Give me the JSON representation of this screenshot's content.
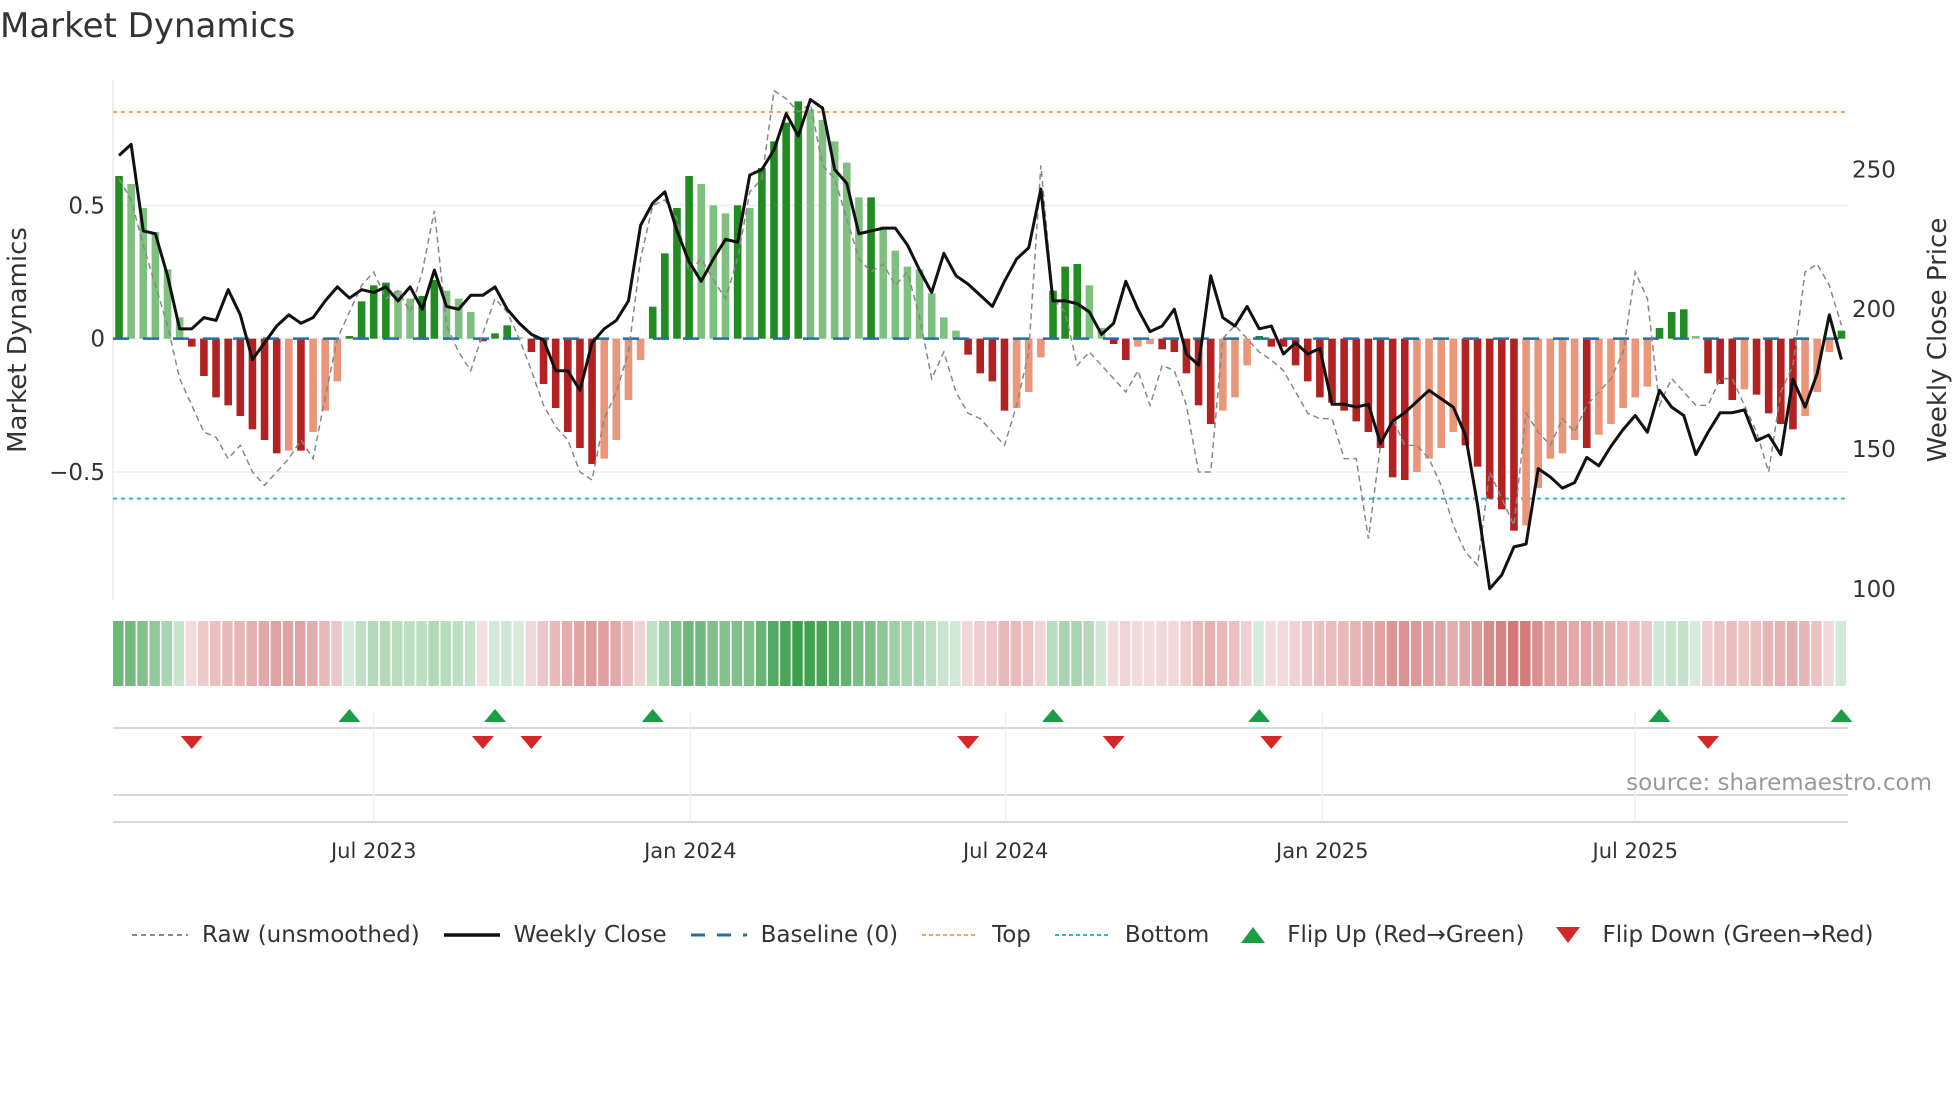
{
  "title": "Market Dynamics",
  "source": "source: sharemaestro.com",
  "colors": {
    "up_strong": "#228b22",
    "up_weak": "#7fbf7f",
    "down_strong": "#b22222",
    "down_weak": "#e9967a",
    "top": "#f4a460",
    "bottom": "#22bcd4",
    "baseline": "#1f6fa8",
    "price": "#111111",
    "raw": "#888888",
    "flip_up": "#1a9e45",
    "flip_down": "#d62728"
  },
  "legend": [
    {
      "key": "raw",
      "label": "Raw (unsmoothed)"
    },
    {
      "key": "price",
      "label": "Weekly Close"
    },
    {
      "key": "baseline",
      "label": "Baseline (0)"
    },
    {
      "key": "top",
      "label": "Top"
    },
    {
      "key": "bottom",
      "label": "Bottom"
    },
    {
      "key": "flip_up",
      "label": "Flip Up (Red→Green)"
    },
    {
      "key": "flip_down",
      "label": "Flip Down (Green→Red)"
    }
  ],
  "chart_data": {
    "type": "bar",
    "ylabel": "Market Dynamics",
    "y2label": "Weekly Close Price",
    "ylim": [
      -0.98,
      0.97
    ],
    "y2lim": [
      96,
      282
    ],
    "yticks": [
      {
        "v": 0.5,
        "label": "0.5"
      },
      {
        "v": 0,
        "label": "0"
      },
      {
        "v": -0.5,
        "label": "−0.5"
      }
    ],
    "y2ticks": [
      {
        "v": 250,
        "label": "250"
      },
      {
        "v": 200,
        "label": "200"
      },
      {
        "v": 150,
        "label": "150"
      },
      {
        "v": 100,
        "label": "100"
      }
    ],
    "xticks": [
      {
        "week": 21,
        "label": "Jul 2023"
      },
      {
        "week": 47.1,
        "label": "Jan 2024"
      },
      {
        "week": 73.1,
        "label": "Jul 2024"
      },
      {
        "week": 99.2,
        "label": "Jan 2025"
      },
      {
        "week": 125,
        "label": "Jul 2025"
      }
    ],
    "top": 0.85,
    "bottom": -0.6,
    "baseline": 0,
    "smoothed": [
      0.61,
      0.58,
      0.49,
      0.4,
      0.26,
      0.08,
      -0.03,
      -0.14,
      -0.22,
      -0.25,
      -0.29,
      -0.34,
      -0.38,
      -0.43,
      -0.42,
      -0.42,
      -0.35,
      -0.27,
      -0.16,
      0.01,
      0.14,
      0.2,
      0.21,
      0.18,
      0.15,
      0.16,
      0.22,
      0.18,
      0.15,
      0.1,
      -0.01,
      0.02,
      0.05,
      0.005,
      -0.05,
      -0.17,
      -0.26,
      -0.35,
      -0.41,
      -0.47,
      -0.45,
      -0.38,
      -0.23,
      -0.08,
      0.12,
      0.32,
      0.49,
      0.61,
      0.58,
      0.5,
      0.47,
      0.5,
      0.49,
      0.64,
      0.74,
      0.81,
      0.89,
      0.86,
      0.82,
      0.74,
      0.66,
      0.53,
      0.53,
      0.42,
      0.33,
      0.27,
      0.26,
      0.17,
      0.08,
      0.03,
      -0.06,
      -0.13,
      -0.16,
      -0.27,
      -0.26,
      -0.2,
      -0.07,
      0.18,
      0.27,
      0.28,
      0.2,
      0.04,
      -0.02,
      -0.08,
      -0.03,
      -0.02,
      -0.04,
      -0.05,
      -0.13,
      -0.25,
      -0.32,
      -0.27,
      -0.22,
      -0.1,
      0.01,
      -0.03,
      -0.03,
      -0.1,
      -0.16,
      -0.22,
      -0.24,
      -0.27,
      -0.31,
      -0.35,
      -0.41,
      -0.52,
      -0.53,
      -0.5,
      -0.45,
      -0.41,
      -0.35,
      -0.4,
      -0.48,
      -0.6,
      -0.64,
      -0.72,
      -0.7,
      -0.56,
      -0.45,
      -0.43,
      -0.38,
      -0.41,
      -0.36,
      -0.32,
      -0.26,
      -0.22,
      -0.18,
      0.04,
      0.1,
      0.11,
      0.01,
      -0.13,
      -0.17,
      -0.23,
      -0.19,
      -0.21,
      -0.28,
      -0.32,
      -0.34,
      -0.29,
      -0.2,
      -0.05,
      0.03
    ],
    "raw": [
      0.6,
      0.52,
      0.35,
      0.2,
      0.05,
      -0.15,
      -0.25,
      -0.35,
      -0.37,
      -0.45,
      -0.4,
      -0.5,
      -0.55,
      -0.5,
      -0.45,
      -0.38,
      -0.45,
      -0.22,
      0.0,
      0.1,
      0.2,
      0.25,
      0.15,
      0.18,
      0.1,
      0.25,
      0.48,
      0.05,
      -0.05,
      -0.12,
      0.02,
      0.15,
      0.1,
      0.0,
      -0.12,
      -0.25,
      -0.33,
      -0.38,
      -0.5,
      -0.53,
      -0.3,
      -0.2,
      -0.05,
      0.3,
      0.5,
      0.52,
      0.45,
      0.25,
      0.3,
      0.22,
      0.15,
      0.3,
      0.55,
      0.6,
      0.93,
      0.9,
      0.85,
      0.88,
      0.65,
      0.6,
      0.45,
      0.3,
      0.25,
      0.28,
      0.2,
      0.25,
      0.08,
      -0.15,
      -0.05,
      -0.2,
      -0.28,
      -0.3,
      -0.35,
      -0.4,
      -0.25,
      -0.05,
      0.65,
      0.15,
      0.1,
      -0.1,
      -0.05,
      -0.1,
      -0.15,
      -0.2,
      -0.12,
      -0.25,
      -0.1,
      -0.12,
      -0.25,
      -0.5,
      -0.5,
      0.0,
      0.05,
      0.0,
      -0.05,
      -0.08,
      -0.12,
      -0.2,
      -0.28,
      -0.3,
      -0.3,
      -0.45,
      -0.45,
      -0.75,
      -0.4,
      -0.3,
      -0.4,
      -0.4,
      -0.45,
      -0.55,
      -0.7,
      -0.8,
      -0.85,
      -0.5,
      -0.6,
      -0.7,
      -0.28,
      -0.35,
      -0.4,
      -0.3,
      -0.35,
      -0.25,
      -0.2,
      -0.15,
      -0.05,
      0.25,
      0.15,
      -0.25,
      -0.15,
      -0.2,
      -0.25,
      -0.25,
      -0.15,
      -0.15,
      -0.25,
      -0.35,
      -0.5,
      -0.2,
      -0.1,
      0.25,
      0.28,
      0.2,
      0.05
    ],
    "price": [
      255,
      259,
      228,
      227,
      212,
      193,
      193,
      197,
      196,
      207,
      198,
      182,
      188,
      194,
      198,
      195,
      197,
      203,
      208,
      204,
      207,
      206,
      208,
      203,
      208,
      200,
      214,
      201,
      200,
      205,
      205,
      208,
      200,
      195,
      191,
      189,
      178,
      178,
      171,
      188,
      193,
      196,
      203,
      230,
      238,
      242,
      228,
      217,
      210,
      218,
      225,
      224,
      248,
      250,
      257,
      270,
      262,
      275,
      272,
      250,
      245,
      227,
      228,
      229,
      229,
      223,
      214,
      206,
      220,
      212,
      209,
      205,
      201,
      210,
      218,
      222,
      243,
      203,
      203,
      202,
      199,
      191,
      195,
      210,
      200,
      192,
      194,
      200,
      184,
      180,
      212,
      197,
      194,
      201,
      193,
      194,
      184,
      188,
      184,
      186,
      166,
      166,
      165,
      166,
      152,
      160,
      163,
      167,
      171,
      168,
      165,
      155,
      130,
      100,
      105,
      115,
      116,
      143,
      140,
      136,
      138,
      147,
      144,
      151,
      157,
      162,
      156,
      171,
      165,
      162,
      148,
      156,
      163,
      163,
      164,
      153,
      155,
      148,
      175,
      165,
      177,
      198,
      182
    ]
  }
}
